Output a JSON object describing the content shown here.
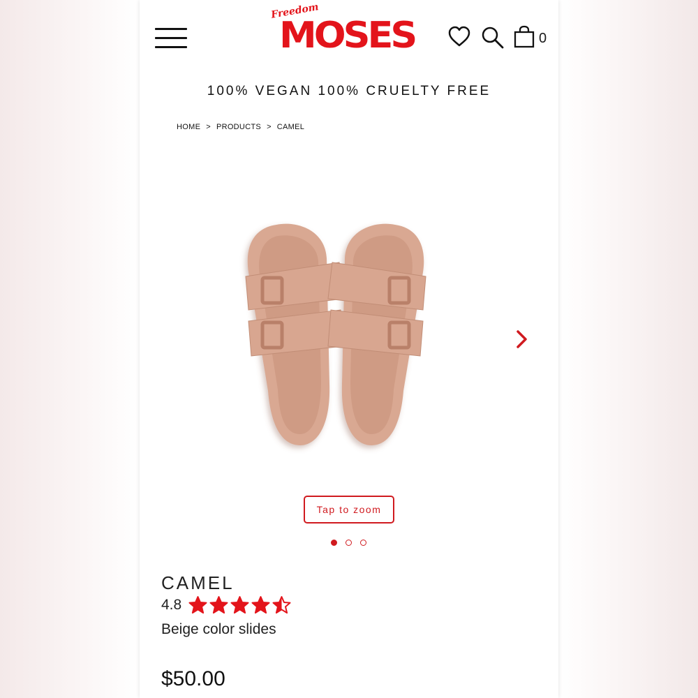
{
  "header": {
    "logo_small": "Freedom",
    "logo_main": "MOSES",
    "cart_count": "0",
    "icons": [
      "menu-icon",
      "heart-icon",
      "search-icon",
      "bag-icon"
    ]
  },
  "tagline": "100% VEGAN 100% CRUELTY FREE",
  "breadcrumb": {
    "items": [
      "HOME",
      "PRODUCTS",
      "CAMEL"
    ],
    "separator": ">"
  },
  "gallery": {
    "zoom_label": "Tap to zoom",
    "slide_count": 3,
    "active_slide": 1
  },
  "product": {
    "name": "CAMEL",
    "rating": "4.8",
    "rating_value": 4.8,
    "rating_max": 5,
    "description": "Beige color slides",
    "price": "$50.00"
  },
  "colors": {
    "brand_red": "#e3141b",
    "accent_red": "#d01a1f",
    "product": "#d7a58f"
  }
}
